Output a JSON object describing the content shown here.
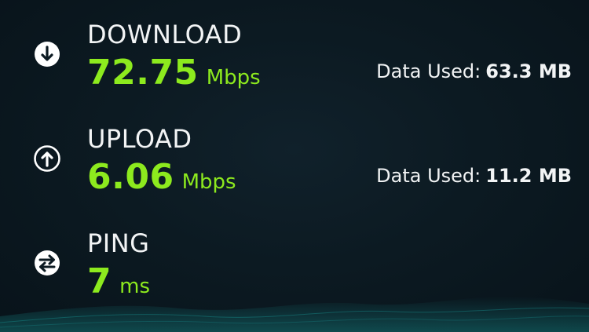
{
  "download": {
    "icon": "download-arrow-icon",
    "label": "DOWNLOAD",
    "value": "72.75",
    "unit": "Mbps",
    "data_used_label": "Data Used:",
    "data_used_value": "63.3 MB"
  },
  "upload": {
    "icon": "upload-arrow-icon",
    "label": "UPLOAD",
    "value": "6.06",
    "unit": "Mbps",
    "data_used_label": "Data Used:",
    "data_used_value": "11.2 MB"
  },
  "ping": {
    "icon": "ping-arrows-icon",
    "label": "PING",
    "value": "7",
    "unit": "ms"
  },
  "colors": {
    "accent_green": "#8dea1e",
    "background": "#0c1a22",
    "wave": "#1aa9a6"
  }
}
